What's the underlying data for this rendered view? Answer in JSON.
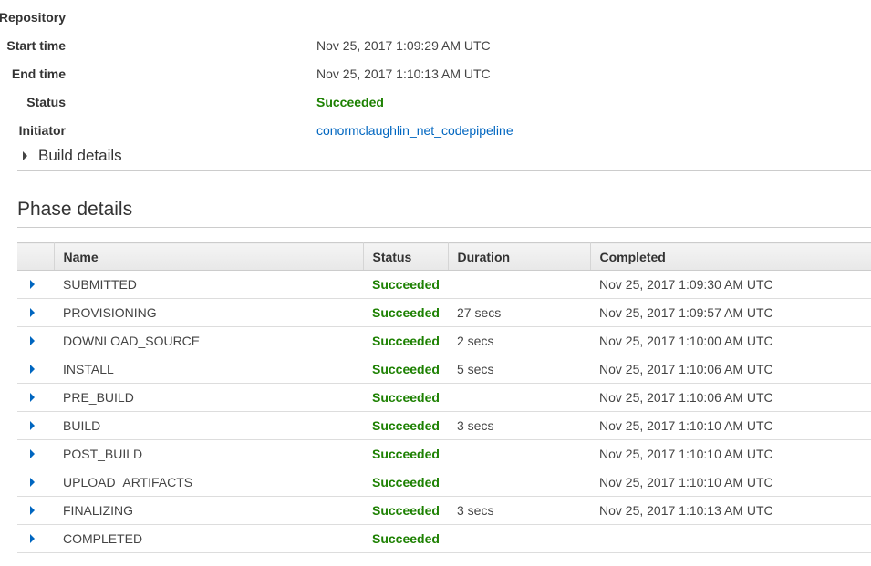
{
  "summary": {
    "repository_label": "Repository",
    "repository_value": "",
    "start_label": "Start time",
    "start_value": "Nov 25, 2017 1:09:29 AM UTC",
    "end_label": "End time",
    "end_value": "Nov 25, 2017 1:10:13 AM UTC",
    "status_label": "Status",
    "status_value": "Succeeded",
    "initiator_label": "Initiator",
    "initiator_value": "conormclaughlin_net_codepipeline"
  },
  "build_details": {
    "label": "Build details"
  },
  "phase_details": {
    "title": "Phase details",
    "columns": [
      "Name",
      "Status",
      "Duration",
      "Completed"
    ],
    "rows": [
      {
        "name": "SUBMITTED",
        "status": "Succeeded",
        "duration": "",
        "completed": "Nov 25, 2017 1:09:30 AM UTC"
      },
      {
        "name": "PROVISIONING",
        "status": "Succeeded",
        "duration": "27 secs",
        "completed": "Nov 25, 2017 1:09:57 AM UTC"
      },
      {
        "name": "DOWNLOAD_SOURCE",
        "status": "Succeeded",
        "duration": "2 secs",
        "completed": "Nov 25, 2017 1:10:00 AM UTC"
      },
      {
        "name": "INSTALL",
        "status": "Succeeded",
        "duration": "5 secs",
        "completed": "Nov 25, 2017 1:10:06 AM UTC"
      },
      {
        "name": "PRE_BUILD",
        "status": "Succeeded",
        "duration": "",
        "completed": "Nov 25, 2017 1:10:06 AM UTC"
      },
      {
        "name": "BUILD",
        "status": "Succeeded",
        "duration": "3 secs",
        "completed": "Nov 25, 2017 1:10:10 AM UTC"
      },
      {
        "name": "POST_BUILD",
        "status": "Succeeded",
        "duration": "",
        "completed": "Nov 25, 2017 1:10:10 AM UTC"
      },
      {
        "name": "UPLOAD_ARTIFACTS",
        "status": "Succeeded",
        "duration": "",
        "completed": "Nov 25, 2017 1:10:10 AM UTC"
      },
      {
        "name": "FINALIZING",
        "status": "Succeeded",
        "duration": "3 secs",
        "completed": "Nov 25, 2017 1:10:13 AM UTC"
      },
      {
        "name": "COMPLETED",
        "status": "Succeeded",
        "duration": "",
        "completed": ""
      }
    ]
  },
  "colors": {
    "success": "#1d8102",
    "link": "#0066c0"
  }
}
